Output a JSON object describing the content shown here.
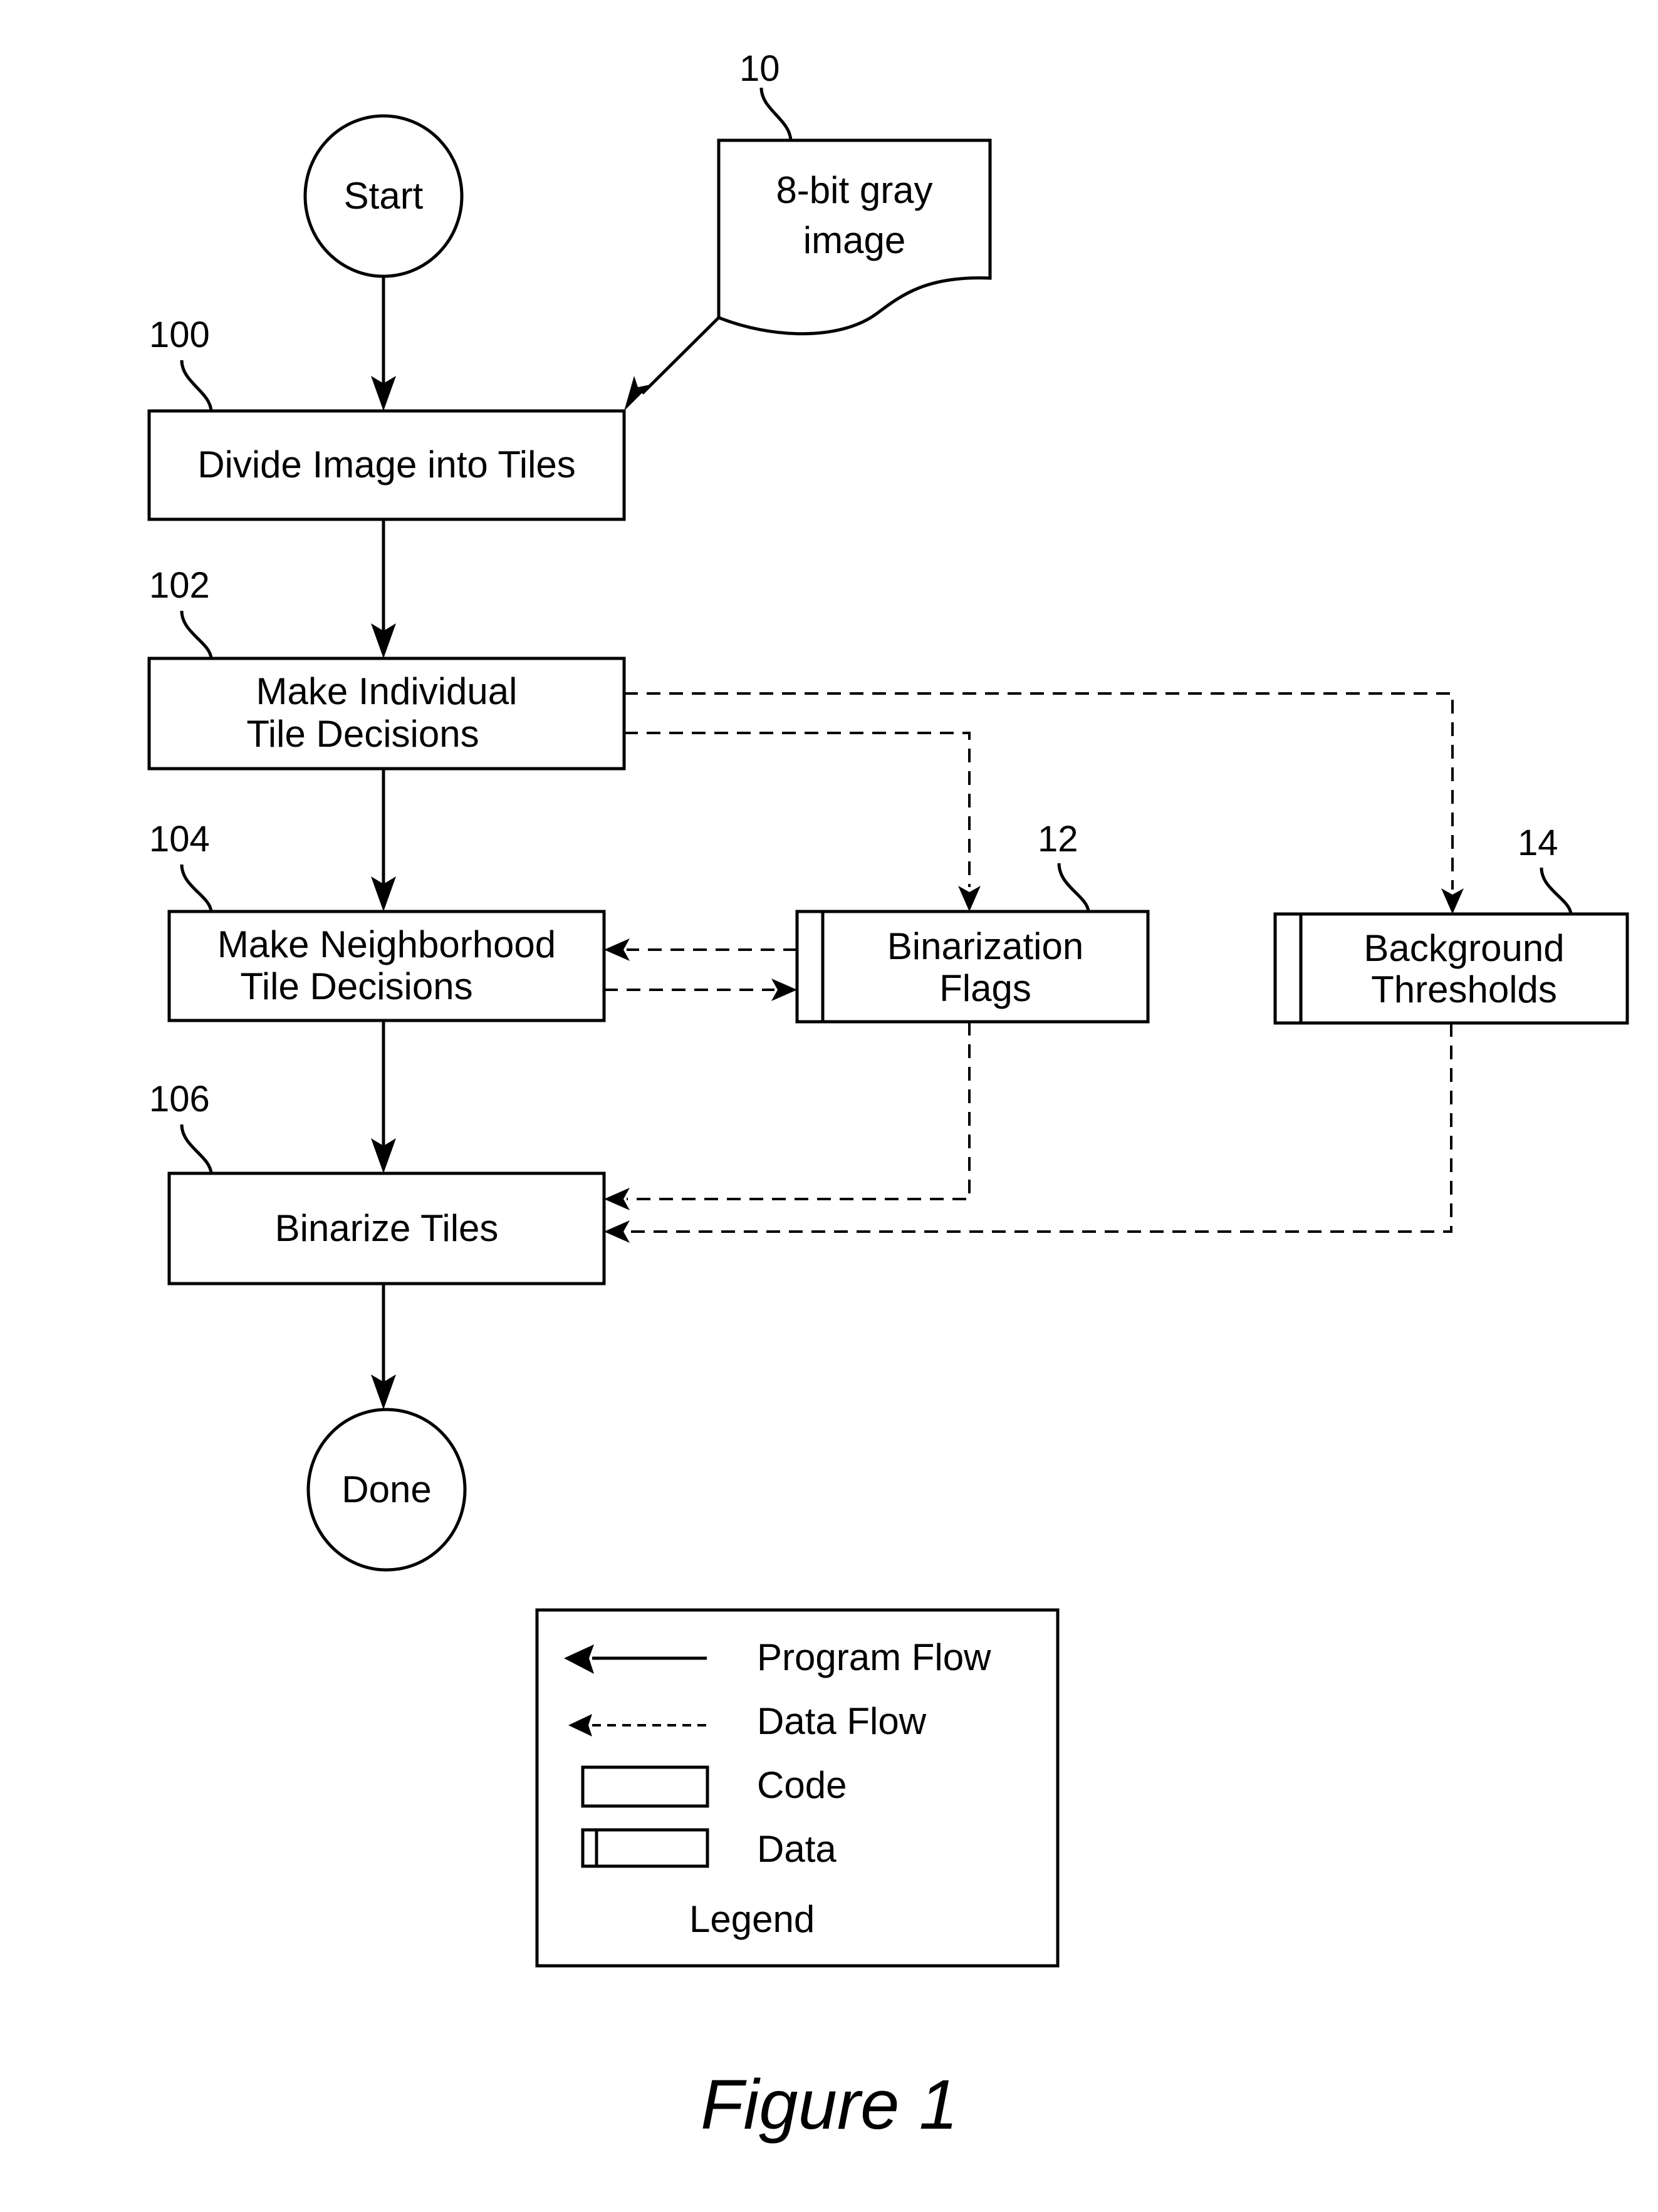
{
  "figure": {
    "caption": "Figure 1",
    "nodes": {
      "start": {
        "label": "Start"
      },
      "done": {
        "label": "Done"
      },
      "input_image": {
        "ref": "10",
        "line1": "8-bit gray",
        "line2": "image"
      },
      "divide": {
        "ref": "100",
        "label": "Divide Image into Tiles"
      },
      "individual": {
        "ref": "102",
        "line1": "Make Individual",
        "line2": "Tile Decisions"
      },
      "neighborhood": {
        "ref": "104",
        "line1": "Make Neighborhood",
        "line2": "Tile Decisions"
      },
      "binarize": {
        "ref": "106",
        "label": "Binarize Tiles"
      },
      "flags": {
        "ref": "12",
        "line1": "Binarization",
        "line2": "Flags"
      },
      "thresholds": {
        "ref": "14",
        "line1": "Background",
        "line2": "Thresholds"
      }
    },
    "edges": [
      {
        "from": "Start",
        "to": "Divide Image into Tiles",
        "type": "program-flow"
      },
      {
        "from": "8-bit gray image",
        "to": "Divide Image into Tiles",
        "type": "program-flow"
      },
      {
        "from": "Divide Image into Tiles",
        "to": "Make Individual Tile Decisions",
        "type": "program-flow"
      },
      {
        "from": "Make Individual Tile Decisions",
        "to": "Make Neighborhood Tile Decisions",
        "type": "program-flow"
      },
      {
        "from": "Make Neighborhood Tile Decisions",
        "to": "Binarize Tiles",
        "type": "program-flow"
      },
      {
        "from": "Binarize Tiles",
        "to": "Done",
        "type": "program-flow"
      },
      {
        "from": "Make Individual Tile Decisions",
        "to": "Binarization Flags",
        "type": "data-flow"
      },
      {
        "from": "Make Individual Tile Decisions",
        "to": "Background Thresholds",
        "type": "data-flow"
      },
      {
        "from": "Binarization Flags",
        "to": "Make Neighborhood Tile Decisions",
        "type": "data-flow"
      },
      {
        "from": "Make Neighborhood Tile Decisions",
        "to": "Binarization Flags",
        "type": "data-flow"
      },
      {
        "from": "Binarization Flags",
        "to": "Binarize Tiles",
        "type": "data-flow"
      },
      {
        "from": "Background Thresholds",
        "to": "Binarize Tiles",
        "type": "data-flow"
      }
    ],
    "legend": {
      "title": "Legend",
      "items": [
        {
          "symbol": "solid-arrow-icon",
          "label": "Program Flow"
        },
        {
          "symbol": "dashed-arrow-icon",
          "label": "Data Flow"
        },
        {
          "symbol": "code-box-icon",
          "label": "Code"
        },
        {
          "symbol": "data-box-icon",
          "label": "Data"
        }
      ]
    }
  }
}
